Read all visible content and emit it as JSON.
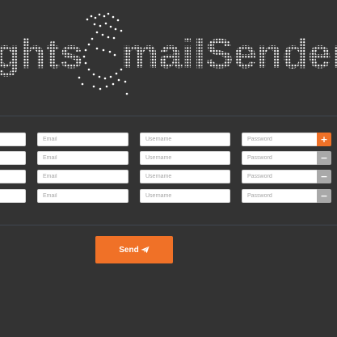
{
  "logo": {
    "left_text": "ghts",
    "right_text": "mailSender"
  },
  "rows": [
    {
      "email_placeholder": "Email",
      "username_placeholder": "Username",
      "password_placeholder": "Password",
      "action_label": "+",
      "action": "add"
    },
    {
      "email_placeholder": "Email",
      "username_placeholder": "Username",
      "password_placeholder": "Password",
      "action_label": "−",
      "action": "remove"
    },
    {
      "email_placeholder": "Email",
      "username_placeholder": "Username",
      "password_placeholder": "Password",
      "action_label": "−",
      "action": "remove"
    },
    {
      "email_placeholder": "Email",
      "username_placeholder": "Username",
      "password_placeholder": "Password",
      "action_label": "−",
      "action": "remove"
    }
  ],
  "send": {
    "label": "Send",
    "icon": "paper-plane-icon"
  },
  "colors": {
    "background": "#333333",
    "accent": "#f07127",
    "remove_button": "#a9a9a9",
    "logo_dots": "#ffffff"
  }
}
